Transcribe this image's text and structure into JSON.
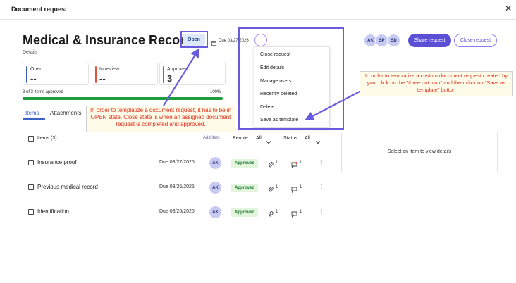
{
  "window": {
    "title": "Document request",
    "close_glyph": "✕"
  },
  "header": {
    "title": "Medical & Insurance Records",
    "subtitle": "Details",
    "status_badge": "Open",
    "due_date": "Due 03/27/2026",
    "more_glyph": "···",
    "avatars": [
      "AK",
      "SP",
      "SD"
    ],
    "share_button": "Share request",
    "close_button": "Close request"
  },
  "stats": [
    {
      "label": "Open",
      "value": "--",
      "color": "#3c5fb0"
    },
    {
      "label": "In review",
      "value": "--",
      "color": "#e0553b"
    },
    {
      "label": "Approved",
      "value": "3",
      "color": "#2a9c3e"
    }
  ],
  "progress": {
    "label": "3 of 3 items approved",
    "percent_text": "100%",
    "fraction": 1.0,
    "color": "#1f9c3d"
  },
  "tabs": [
    "Items",
    "Attachments"
  ],
  "list_header": {
    "items_label": "Items (3)",
    "add_item": "Add item",
    "people_label": "People",
    "people_value": "All",
    "status_label": "Status",
    "status_value": "All"
  },
  "rows": [
    {
      "name": "Insurance proof",
      "due": "Due 03/27/2025",
      "assignee": "AK",
      "status": "Approved",
      "attachments": "1",
      "comments": "1",
      "comment_alert": true
    },
    {
      "name": "Previous medical record",
      "due": "Due 03/26/2025",
      "assignee": "AK",
      "status": "Approved",
      "attachments": "1",
      "comments": "1",
      "comment_alert": false
    },
    {
      "name": "Identification",
      "due": "Due 03/26/2025",
      "assignee": "AK",
      "status": "Approved",
      "attachments": "1",
      "comments": "1",
      "comment_alert": false
    }
  ],
  "kebab_glyph": "⋮",
  "details_panel": {
    "message": "Select an item to view details"
  },
  "menu": {
    "items": [
      "Close request",
      "Edit details",
      "Manage users",
      "Recently deleted",
      "Delete",
      "Save as template"
    ]
  },
  "annotations": {
    "left_note": "In order to templatize a document request, it has to be in OPEN state. Close state is when an assigned document request is completed and approved.",
    "right_note": "In order to templatize a custom document request created by you,  click on the \"three dot icon\" and then click on \"Save as template\" button"
  },
  "colors": {
    "accent": "#5b4fd6",
    "highlight": "#6a5bde",
    "note_text": "#e0301e",
    "approved_bg": "#e3f5dd",
    "approved_text": "#1d7a34"
  },
  "icons": [
    "close-icon",
    "calendar-icon",
    "more-icon",
    "checkbox-icon",
    "chevron-down-icon",
    "paperclip-icon",
    "comment-icon",
    "kebab-icon"
  ]
}
